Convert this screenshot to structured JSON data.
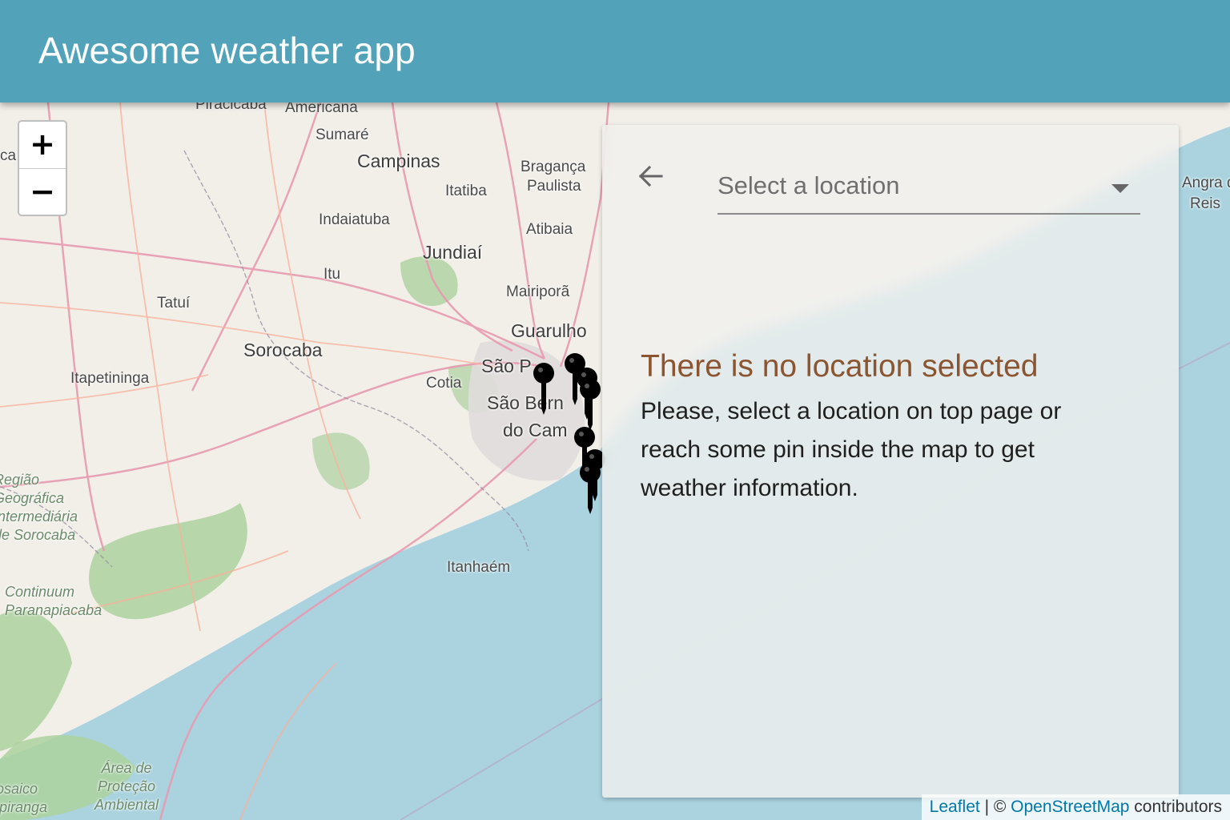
{
  "app": {
    "title": "Awesome weather app"
  },
  "map": {
    "zoom_in_label": "+",
    "zoom_out_label": "−",
    "places": [
      "Piracicaba",
      "Americana",
      "Sumaré",
      "Campinas",
      "Bragança",
      "Paulista",
      "Itatiba",
      "Indaiatuba",
      "Atibaia",
      "Jundiaí",
      "Itu",
      "Mairiporã",
      "Tatuí",
      "Guarulho",
      "Sorocaba",
      "São P",
      "Itapetininga",
      "Cotia",
      "São Bern",
      "do Cam",
      "Itanhaém",
      "Angra do",
      "Reis",
      "ca"
    ],
    "regions": [
      "Região\nGeográfica\nIntermediária\nde Sorocaba",
      "Continuum\nParanapiacaba",
      "Área de\nProteção\nAmbiental",
      "Mosaico\nJupiranga"
    ],
    "pin_count": 7,
    "colors": {
      "land": "#f2efe9",
      "water": "#aad3df",
      "forest": "#add19e",
      "road": "#e89ab0"
    }
  },
  "panel": {
    "select_placeholder": "Select a location",
    "back_icon": "arrow-left-icon",
    "empty_title": "There is no location selected",
    "empty_message": "Please, select a location on top page or reach some pin inside the map to get weather information."
  },
  "attribution": {
    "leaflet": "Leaflet",
    "separator": " | © ",
    "osm": "OpenStreetMap",
    "suffix": " contributors"
  }
}
